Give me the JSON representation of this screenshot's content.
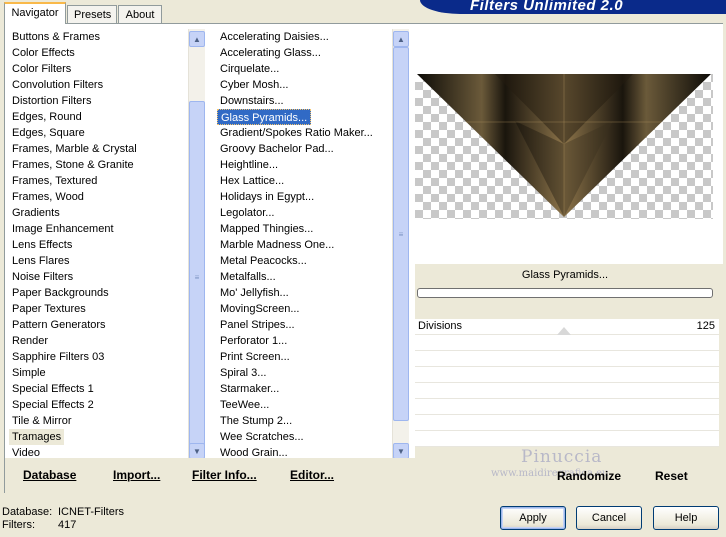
{
  "tabs": [
    "Navigator",
    "Presets",
    "About"
  ],
  "banner_title": "Filters Unlimited 2.0",
  "categories": [
    "Buttons & Frames",
    "Color Effects",
    "Color Filters",
    "Convolution Filters",
    "Distortion Filters",
    "Edges, Round",
    "Edges, Square",
    "Frames, Marble & Crystal",
    "Frames, Stone & Granite",
    "Frames, Textured",
    "Frames, Wood",
    "Gradients",
    "Image Enhancement",
    "Lens Effects",
    "Lens Flares",
    "Noise Filters",
    "Paper Backgrounds",
    "Paper Textures",
    "Pattern Generators",
    "Render",
    "Sapphire Filters 03",
    "Simple",
    "Special Effects 1",
    "Special Effects 2",
    "Tile & Mirror",
    "Tramages",
    "Video"
  ],
  "categories_selected": 25,
  "filters": [
    "Accelerating Daisies...",
    "Accelerating Glass...",
    "Cirquelate...",
    "Cyber Mosh...",
    "Downstairs...",
    "Glass Pyramids...",
    "Gradient/Spokes Ratio Maker...",
    "Groovy Bachelor Pad...",
    "Heightline...",
    "Hex Lattice...",
    "Holidays in Egypt...",
    "Legolator...",
    "Mapped Thingies...",
    "Marble Madness One...",
    "Metal Peacocks...",
    "Metalfalls...",
    "Mo' Jellyfish...",
    "MovingScreen...",
    "Panel Stripes...",
    "Perforator 1...",
    "Print Screen...",
    "Spiral 3...",
    "Starmaker...",
    "TeeWee...",
    "The Stump 2...",
    "Wee Scratches...",
    "Wood Grain..."
  ],
  "filters_selected": 5,
  "bottom_buttons": {
    "database": "Database",
    "import": "Import...",
    "filter_info": "Filter Info...",
    "editor": "Editor..."
  },
  "preview_filter_name": "Glass Pyramids...",
  "slider": {
    "label": "Divisions",
    "value": "125"
  },
  "right_buttons": {
    "randomize": "Randomize",
    "reset": "Reset"
  },
  "watermark": {
    "name": "Pinuccia",
    "site": "www.maidiregrafica.eu"
  },
  "status": {
    "database_label": "Database:",
    "database_value": "ICNET-Filters",
    "filters_label": "Filters:",
    "filters_value": "417"
  },
  "dialog_buttons": {
    "apply": "Apply",
    "cancel": "Cancel",
    "help": "Help"
  },
  "colors": {
    "selection": "#316ac5",
    "banner": "#0a2a8a",
    "accent_tab": "#f9b94a"
  }
}
